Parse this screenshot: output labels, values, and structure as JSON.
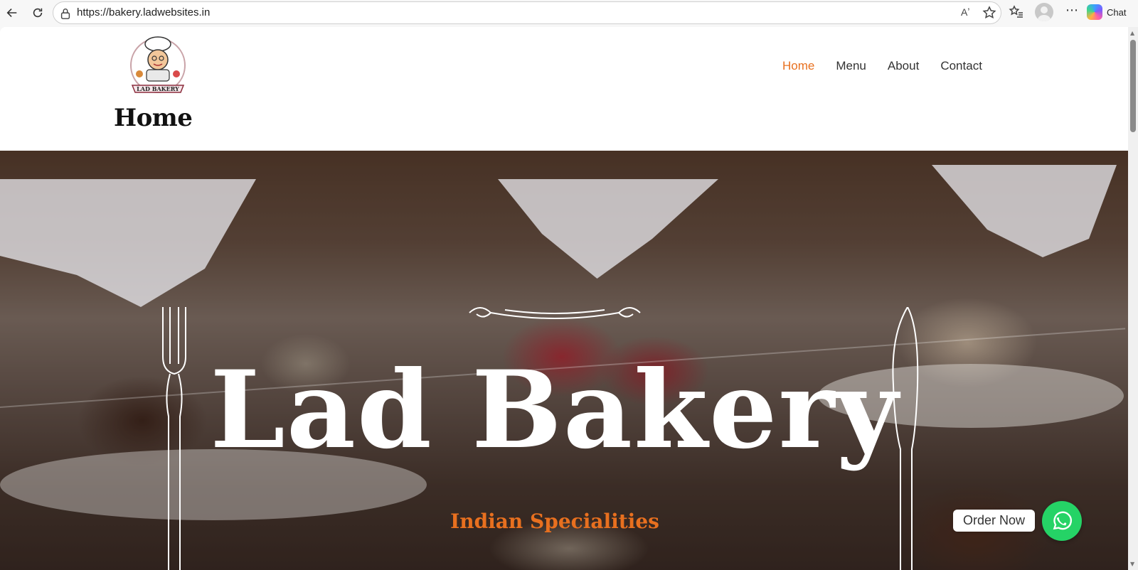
{
  "browser": {
    "url": "https://bakery.ladwebsites.in",
    "chat_label": "Chat",
    "read_aloud_glyph": "Aʼ",
    "more_glyph": "⋯"
  },
  "header": {
    "page_heading": "Home",
    "logo_text": "LAD BAKERY",
    "nav": [
      {
        "label": "Home",
        "active": true
      },
      {
        "label": "Menu",
        "active": false
      },
      {
        "label": "About",
        "active": false
      },
      {
        "label": "Contact",
        "active": false
      }
    ]
  },
  "hero": {
    "title": "Lad Bakery",
    "subtitle": "Indian Specialities"
  },
  "floating": {
    "order_label": "Order Now"
  },
  "colors": {
    "accent": "#e8701f",
    "whatsapp": "#25d366"
  },
  "icons": [
    "back-icon",
    "reload-icon",
    "lock-icon",
    "read-aloud-icon",
    "star-icon",
    "favorites-icon",
    "profile-icon",
    "more-icon",
    "copilot-icon",
    "whatsapp-icon",
    "fork-icon",
    "knife-icon"
  ]
}
